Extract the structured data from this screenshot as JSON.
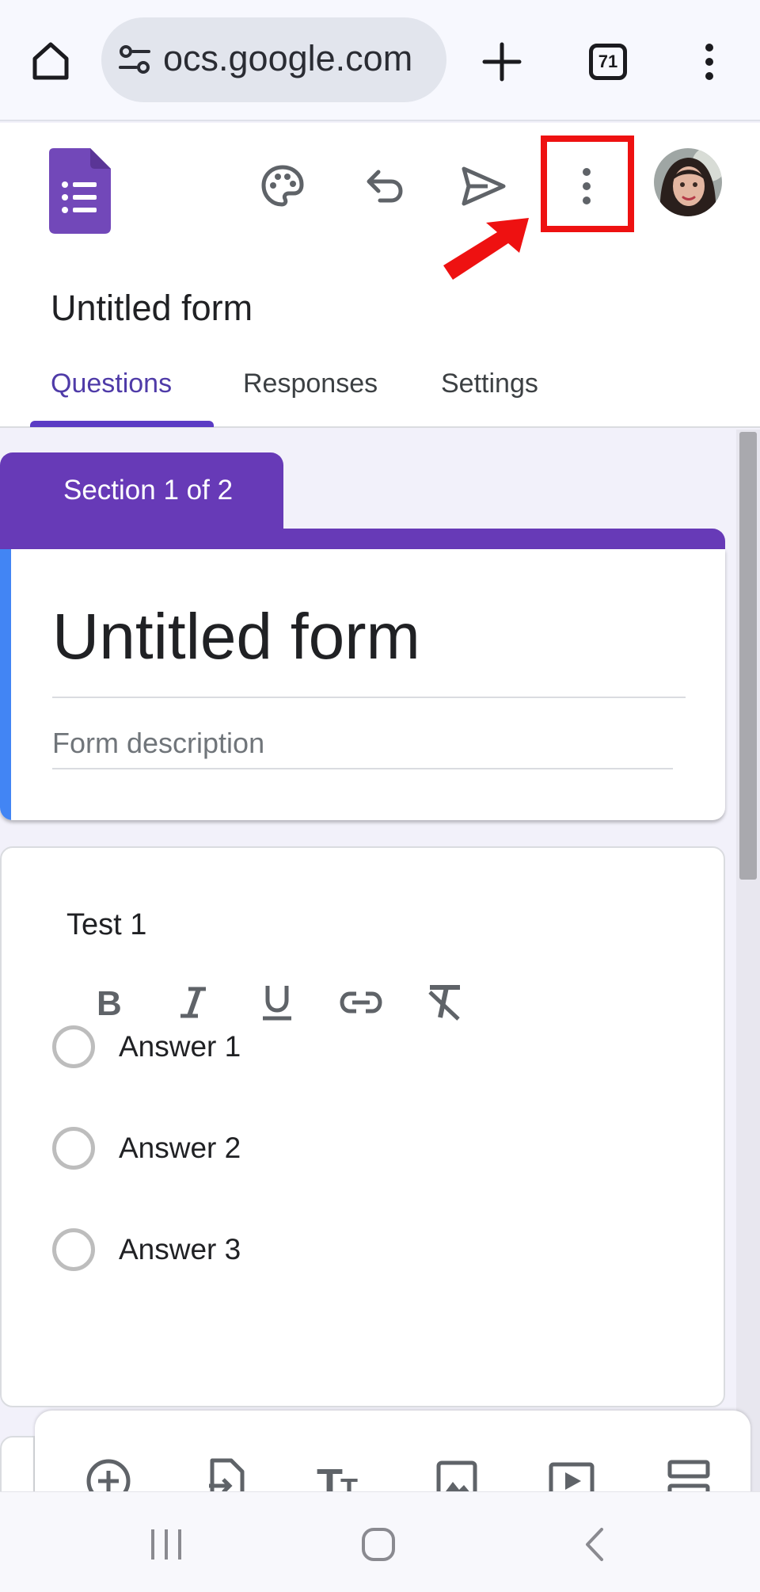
{
  "browser": {
    "url_text": "ocs.google.com",
    "tab_count": "71",
    "icons": [
      "home-icon",
      "site-settings-icon",
      "plus-icon",
      "tab-switcher-icon",
      "more-vert-icon"
    ]
  },
  "header": {
    "form_name": "Untitled form",
    "tabs": [
      {
        "label": "Questions",
        "active": true
      },
      {
        "label": "Responses",
        "active": false
      },
      {
        "label": "Settings",
        "active": false
      }
    ],
    "icons": [
      "forms-logo-icon",
      "palette-icon",
      "undo-icon",
      "send-icon",
      "more-vert-icon"
    ],
    "annotation": {
      "highlight_color": "#ee1111",
      "target": "more-options-button"
    },
    "accent_color": "#673ab7"
  },
  "section": {
    "label": "Section 1 of 2"
  },
  "form": {
    "title": "Untitled form",
    "description_placeholder": "Form description",
    "accent_color": "#4285f4"
  },
  "question": {
    "title": "Test 1",
    "format_tools": [
      "bold-icon",
      "italic-icon",
      "underline-icon",
      "link-icon",
      "clear-format-icon"
    ],
    "options": [
      "Answer 1",
      "Answer 2",
      "Answer 3"
    ]
  },
  "toolbar": {
    "items": [
      "add-question-icon",
      "import-questions-icon",
      "add-title-icon",
      "add-image-icon",
      "add-video-icon",
      "add-section-icon"
    ]
  },
  "android_nav": {
    "items": [
      "recents-icon",
      "home-circle-icon",
      "back-icon"
    ]
  }
}
